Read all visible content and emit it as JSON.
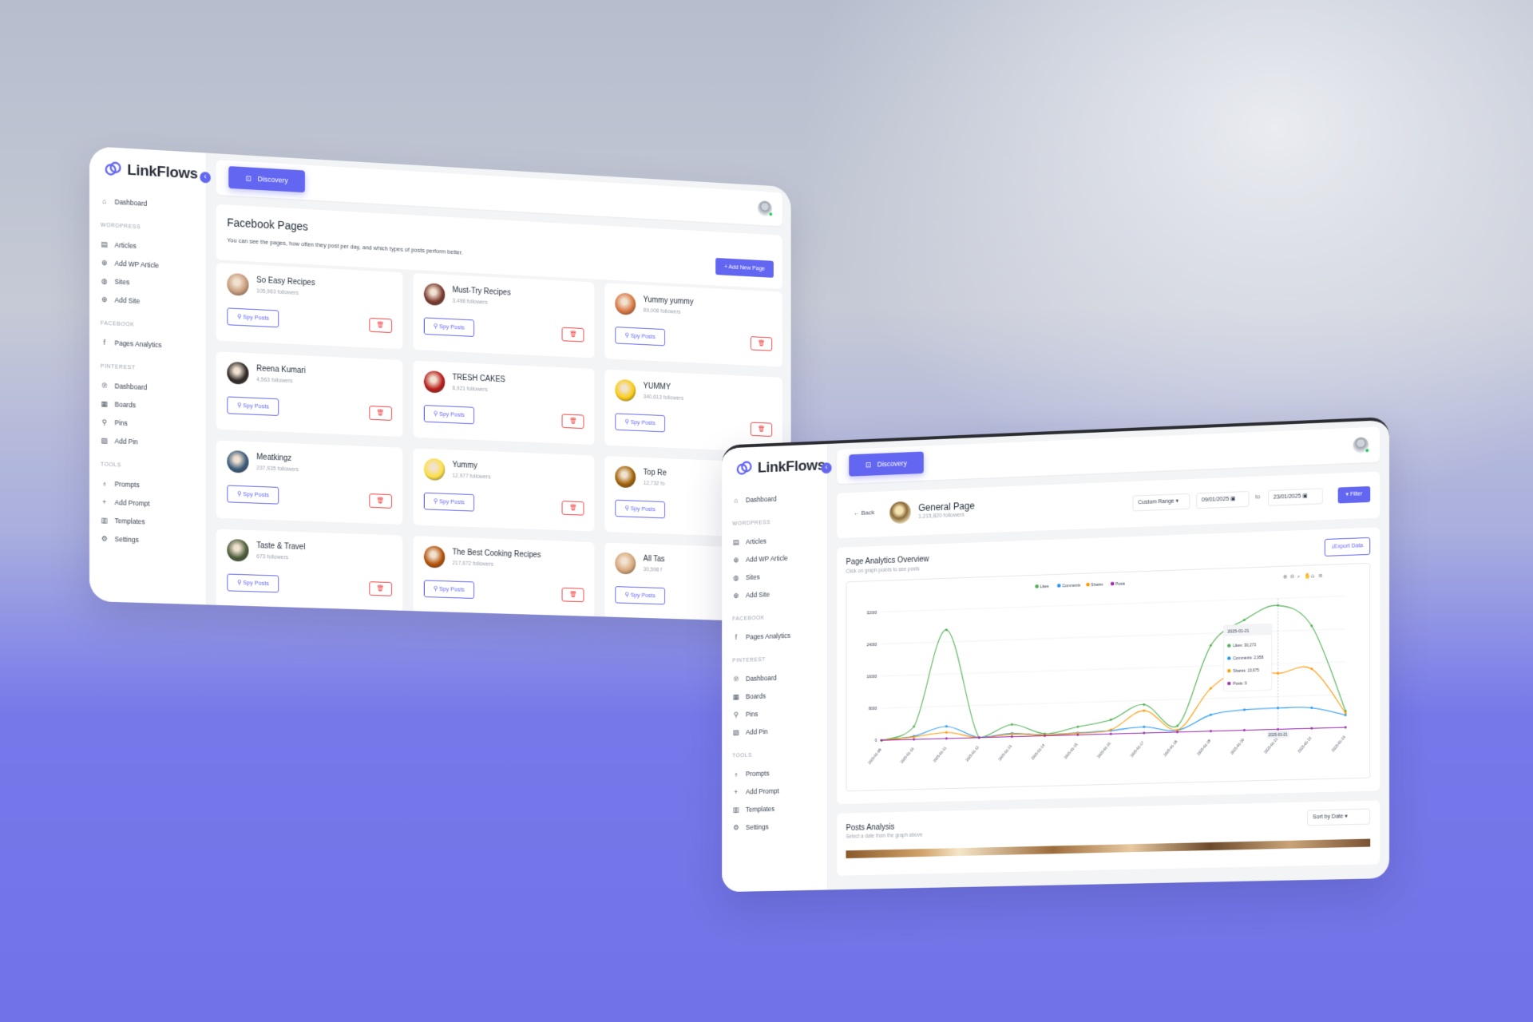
{
  "brand": {
    "name": "LinkFlows",
    "accent": "#6366f1"
  },
  "sidebar": {
    "dashboard": "Dashboard",
    "sections": [
      {
        "title": "WORDPRESS",
        "items": [
          {
            "label": "Articles",
            "icon": "file-icon"
          },
          {
            "label": "Add WP Article",
            "icon": "plus-circle-icon"
          },
          {
            "label": "Sites",
            "icon": "globe-icon"
          },
          {
            "label": "Add Site",
            "icon": "plus-circle-icon"
          }
        ]
      },
      {
        "title": "FACEBOOK",
        "items": [
          {
            "label": "Pages Analytics",
            "icon": "facebook-icon"
          }
        ]
      },
      {
        "title": "PINTEREST",
        "items": [
          {
            "label": "Dashboard",
            "icon": "pinterest-icon"
          },
          {
            "label": "Boards",
            "icon": "grid-icon"
          },
          {
            "label": "Pins",
            "icon": "pin-icon"
          },
          {
            "label": "Add Pin",
            "icon": "add-image-icon"
          }
        ]
      },
      {
        "title": "TOOLS",
        "items": [
          {
            "label": "Prompts",
            "icon": "bulb-icon"
          },
          {
            "label": "Add Prompt",
            "icon": "plus-icon"
          },
          {
            "label": "Templates",
            "icon": "layout-icon"
          },
          {
            "label": "Settings",
            "icon": "gear-icon"
          }
        ]
      }
    ]
  },
  "topbar": {
    "discovery_label": "Discovery"
  },
  "facebook_pages": {
    "title": "Facebook Pages",
    "subtitle": "You can see the pages, how often they post per day, and which types of posts perform better.",
    "add_label": "+ Add New Page",
    "spy_label": "Spy Posts",
    "cards": [
      {
        "name": "So Easy Recipes",
        "followers": "105,963 followers",
        "color": "#c89b7b"
      },
      {
        "name": "Must-Try Recipes",
        "followers": "3,498 followers",
        "color": "#7c3a2f"
      },
      {
        "name": "Yummy yummy",
        "followers": "89,008 followers",
        "color": "#d97742"
      },
      {
        "name": "Reena Kumari",
        "followers": "4,563 followers",
        "color": "#2f2a28"
      },
      {
        "name": "TRESH CAKES",
        "followers": "8,921 followers",
        "color": "#b91c1c"
      },
      {
        "name": "YUMMY",
        "followers": "340,613 followers",
        "color": "#facc15"
      },
      {
        "name": "Meatkingz",
        "followers": "237,935 followers",
        "color": "#3b5b7a"
      },
      {
        "name": "Yummy",
        "followers": "12,977 followers",
        "color": "#fde047"
      },
      {
        "name": "Top Re",
        "followers": "12,732 fo",
        "color": "#a16207"
      },
      {
        "name": "Taste & Travel",
        "followers": "673 followers",
        "color": "#4b5d3a"
      },
      {
        "name": "The Best Cooking Recipes",
        "followers": "217,672 followers",
        "color": "#b45309"
      },
      {
        "name": "All Tas",
        "followers": "30,598 f",
        "color": "#d6a77a"
      }
    ]
  },
  "general_page": {
    "back_label": "← Back",
    "name": "General Page",
    "followers": "1,215,820 followers",
    "range_select": "Custom Range",
    "date_from": "09/01/2025",
    "to_label": "to",
    "date_to": "23/01/2025",
    "filter_label": "▾ Filter"
  },
  "analytics": {
    "title": "Page Analytics Overview",
    "subtitle": "Click on graph points to see posts",
    "export_label": "Export Data"
  },
  "chart_data": {
    "type": "line",
    "x": [
      "2025-01-09",
      "2025-01-10",
      "2025-01-11",
      "2025-01-12",
      "2025-01-13",
      "2025-01-14",
      "2025-01-15",
      "2025-01-16",
      "2025-01-17",
      "2025-01-18",
      "2025-01-19",
      "2025-01-20",
      "2025-01-21",
      "2025-01-22",
      "2025-01-23"
    ],
    "ylim": [
      0,
      32000
    ],
    "yticks": [
      "0",
      "8000",
      "16000",
      "24000",
      "32000"
    ],
    "series": [
      {
        "name": "Likes",
        "color": "#4caf50",
        "values": [
          0,
          3200,
          27000,
          0,
          3000,
          500,
          2000,
          3500,
          7000,
          1500,
          21000,
          27000,
          30273,
          25000,
          4000
        ]
      },
      {
        "name": "Comments",
        "color": "#2196f3",
        "values": [
          0,
          800,
          3000,
          0,
          800,
          200,
          500,
          800,
          1500,
          400,
          4000,
          5000,
          5200,
          5000,
          3000
        ]
      },
      {
        "name": "Shares",
        "color": "#ff9800",
        "values": [
          0,
          600,
          1500,
          0,
          600,
          200,
          400,
          1000,
          5500,
          500,
          10500,
          15000,
          13675,
          14500,
          3500
        ]
      },
      {
        "name": "Posts",
        "color": "#9c27b0",
        "values": [
          0,
          0,
          0,
          0,
          0,
          0,
          0,
          0,
          0,
          0,
          0,
          0,
          9,
          0,
          0
        ]
      }
    ],
    "tooltip": {
      "date": "2025-01-21",
      "lines": [
        "Likes: 30,273",
        "Comments: 2,958",
        "Shares: 13,675",
        "Posts: 9"
      ]
    }
  },
  "posts_analysis": {
    "title": "Posts Analysis",
    "subtitle": "Select a date from the graph above",
    "sort_label": "Sort by Date"
  }
}
